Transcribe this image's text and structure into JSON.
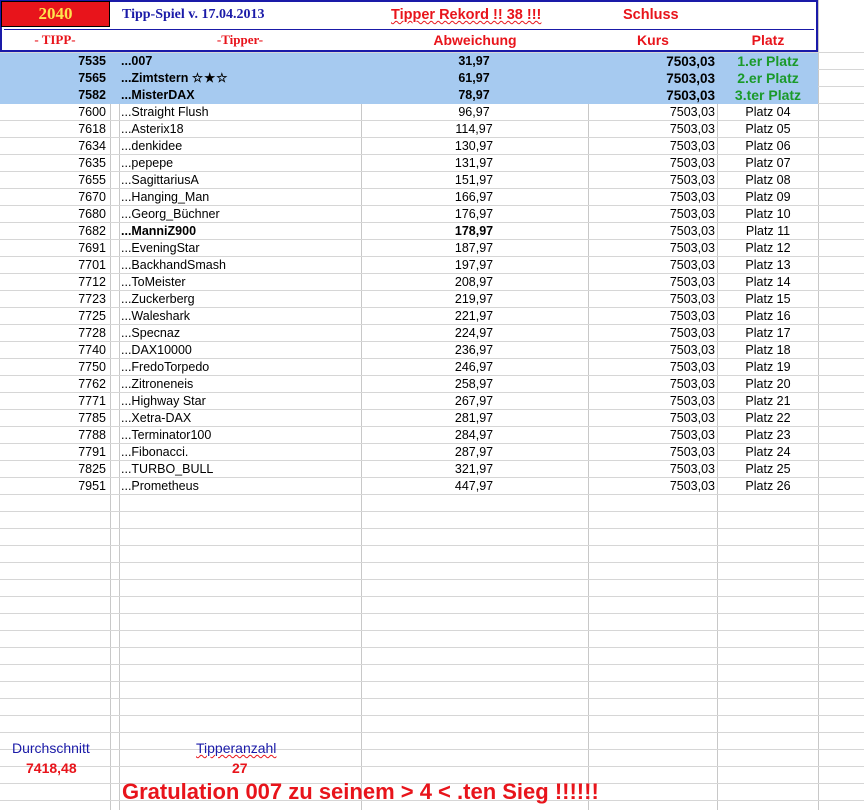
{
  "header": {
    "year": "2040",
    "title": "Tipp-Spiel v. 17.04.2013",
    "record": "Tipper Rekord !!  38  !!!",
    "schluss": "Schluss",
    "col_tipp": "- TIPP-",
    "col_tipper": "-Tipper-",
    "col_abweichung": "Abweichung",
    "col_kurs": "Kurs",
    "col_platz": "Platz"
  },
  "rows": [
    {
      "tipp": "7535",
      "name": "...007",
      "dev": "31,97",
      "kurs": "7503,03",
      "platz": "1.er Platz"
    },
    {
      "tipp": "7565",
      "name": "...Zimtstern",
      "stars": "☆★☆",
      "dev": "61,97",
      "kurs": "7503,03",
      "platz": "2.er Platz"
    },
    {
      "tipp": "7582",
      "name": "...MisterDAX",
      "dev": "78,97",
      "kurs": "7503,03",
      "platz": "3.ter Platz"
    },
    {
      "tipp": "7600",
      "name": "...Straight Flush",
      "dev": "96,97",
      "kurs": "7503,03",
      "platz": "Platz 04"
    },
    {
      "tipp": "7618",
      "name": "...Asterix18",
      "dev": "114,97",
      "kurs": "7503,03",
      "platz": "Platz 05"
    },
    {
      "tipp": "7634",
      "name": "...denkidee",
      "dev": "130,97",
      "kurs": "7503,03",
      "platz": "Platz 06"
    },
    {
      "tipp": "7635",
      "name": "...pepepe",
      "dev": "131,97",
      "kurs": "7503,03",
      "platz": "Platz 07"
    },
    {
      "tipp": "7655",
      "name": "...SagittariusA",
      "dev": "151,97",
      "kurs": "7503,03",
      "platz": "Platz 08"
    },
    {
      "tipp": "7670",
      "name": "...Hanging_Man",
      "dev": "166,97",
      "kurs": "7503,03",
      "platz": "Platz 09"
    },
    {
      "tipp": "7680",
      "name": "...Georg_Büchner",
      "dev": "176,97",
      "kurs": "7503,03",
      "platz": "Platz 10"
    },
    {
      "tipp": "7682",
      "name": "...ManniZ900",
      "dev": "178,97",
      "kurs": "7503,03",
      "platz": "Platz 11",
      "bold": true
    },
    {
      "tipp": "7691",
      "name": "...EveningStar",
      "dev": "187,97",
      "kurs": "7503,03",
      "platz": "Platz 12"
    },
    {
      "tipp": "7701",
      "name": "...BackhandSmash",
      "dev": "197,97",
      "kurs": "7503,03",
      "platz": "Platz 13"
    },
    {
      "tipp": "7712",
      "name": "...ToMeister",
      "dev": "208,97",
      "kurs": "7503,03",
      "platz": "Platz 14"
    },
    {
      "tipp": "7723",
      "name": "...Zuckerberg",
      "dev": "219,97",
      "kurs": "7503,03",
      "platz": "Platz 15"
    },
    {
      "tipp": "7725",
      "name": "...Waleshark",
      "dev": "221,97",
      "kurs": "7503,03",
      "platz": "Platz 16"
    },
    {
      "tipp": "7728",
      "name": "...Specnaz",
      "dev": "224,97",
      "kurs": "7503,03",
      "platz": "Platz 17"
    },
    {
      "tipp": "7740",
      "name": "...DAX10000",
      "dev": "236,97",
      "kurs": "7503,03",
      "platz": "Platz 18"
    },
    {
      "tipp": "7750",
      "name": "...FredoTorpedo",
      "dev": "246,97",
      "kurs": "7503,03",
      "platz": "Platz 19"
    },
    {
      "tipp": "7762",
      "name": "...Zitroneneis",
      "dev": "258,97",
      "kurs": "7503,03",
      "platz": "Platz 20"
    },
    {
      "tipp": "7771",
      "name": "...Highway Star",
      "dev": "267,97",
      "kurs": "7503,03",
      "platz": "Platz 21"
    },
    {
      "tipp": "7785",
      "name": "...Xetra-DAX",
      "dev": "281,97",
      "kurs": "7503,03",
      "platz": "Platz 22"
    },
    {
      "tipp": "7788",
      "name": "...Terminator100",
      "dev": "284,97",
      "kurs": "7503,03",
      "platz": "Platz 23"
    },
    {
      "tipp": "7791",
      "name": "...Fibonacci.",
      "dev": "287,97",
      "kurs": "7503,03",
      "platz": "Platz 24"
    },
    {
      "tipp": "7825",
      "name": "...TURBO_BULL",
      "dev": "321,97",
      "kurs": "7503,03",
      "platz": "Platz 25"
    },
    {
      "tipp": "7951",
      "name": "...Prometheus",
      "dev": "447,97",
      "kurs": "7503,03",
      "platz": "Platz 26"
    }
  ],
  "footer": {
    "durchschnitt_label": "Durchschnitt",
    "durchschnitt_value": "7418,48",
    "tipperanzahl_label": "Tipperanzahl",
    "tipperanzahl_value": "27",
    "gratulation": "Gratulation 007 zu seinem > 4 < .ten Sieg !!!!!!"
  },
  "colors": {
    "header_red": "#e8141b",
    "header_blue": "#1a1aa8",
    "top3_fill": "#a6caf0",
    "top3_platz": "#1a9a2a"
  }
}
